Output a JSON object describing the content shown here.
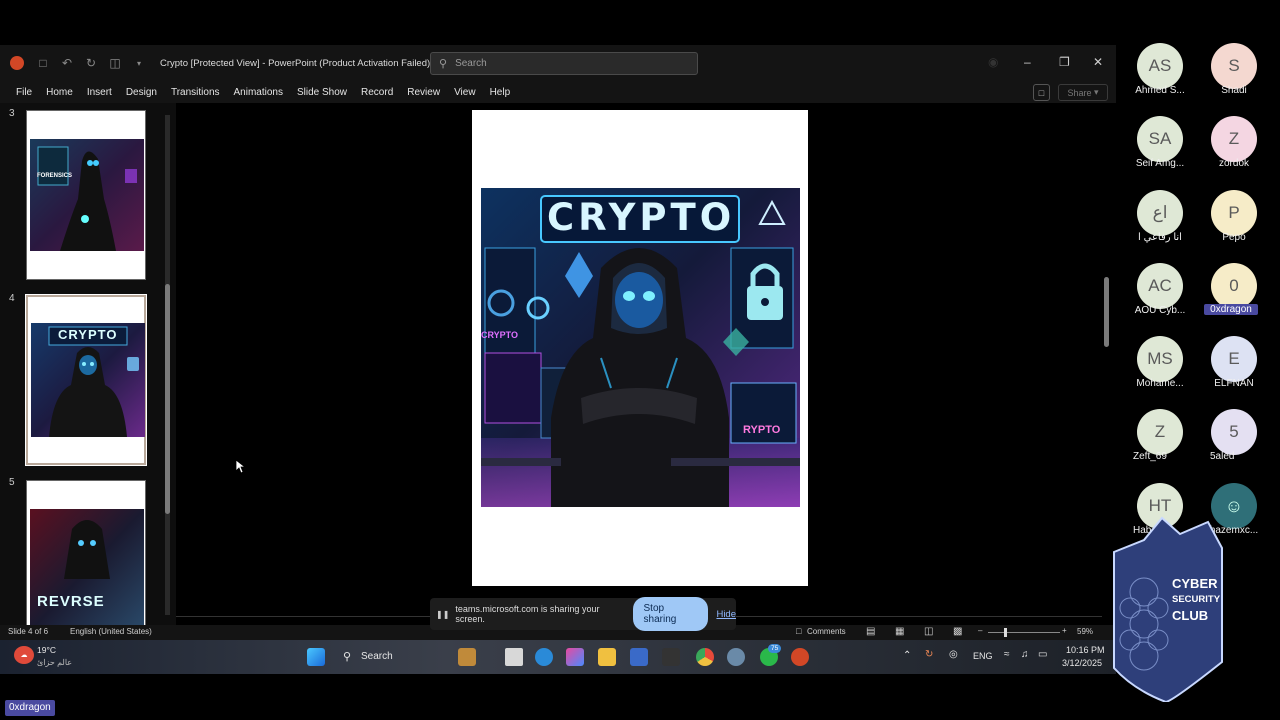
{
  "window": {
    "title": "Crypto [Protected View]  -  PowerPoint (Product Activation Failed)",
    "search_placeholder": "Search"
  },
  "menu": [
    "File",
    "Home",
    "Insert",
    "Design",
    "Transitions",
    "Animations",
    "Slide Show",
    "Record",
    "Review",
    "View",
    "Help"
  ],
  "share_label": "Share",
  "thumbnails": [
    {
      "num": "3",
      "label": "FORENSICS"
    },
    {
      "num": "4",
      "label": "CRYPTO"
    },
    {
      "num": "5",
      "label": "REVRSE"
    }
  ],
  "slide": {
    "title": "CRYPTO",
    "side_text": "CRYPTO",
    "screen_text": "RYPTO"
  },
  "status": {
    "slide_of": "Slide 4 of 6",
    "language": "English (United States)",
    "comments": "Comments",
    "zoom": "59%"
  },
  "share_banner": {
    "message": "teams.microsoft.com is sharing your screen.",
    "stop": "Stop sharing",
    "hide": "Hide"
  },
  "taskbar": {
    "weather_temp": "19°C",
    "weather_desc": "عالم حزائ",
    "search": "Search",
    "lang": "ENG",
    "time": "10:16 PM",
    "date": "3/12/2025",
    "badge_count": "75"
  },
  "participants": [
    {
      "initials": "AS",
      "name": "Ahmed S...",
      "color": "#dfe8d6"
    },
    {
      "initials": "S",
      "name": "Shadi",
      "color": "#f4d8d0"
    },
    {
      "initials": "SA",
      "name": "Seif Amg...",
      "color": "#dfe8d6"
    },
    {
      "initials": "Z",
      "name": "zordok",
      "color": "#f4d6e2"
    },
    {
      "initials": "اع",
      "name": "انا رفاعي ا",
      "color": "#dfe8d6"
    },
    {
      "initials": "P",
      "name": "Pepo",
      "color": "#f6ecc8"
    },
    {
      "initials": "AC",
      "name": "AOU Cyb...",
      "color": "#dfe8d6"
    },
    {
      "initials": "0",
      "name": "0xdragon",
      "color": "#f6ecc8"
    },
    {
      "initials": "MS",
      "name": "Mohame...",
      "color": "#dfe8d6"
    },
    {
      "initials": "E",
      "name": "ELFNAN",
      "color": "#dde2f3"
    },
    {
      "initials": "Z",
      "name": "Zeft_69",
      "color": "#dfe8d6"
    },
    {
      "initials": "5",
      "name": "5aled",
      "color": "#e4e0f2"
    },
    {
      "initials": "HT",
      "name": "Hab...",
      "color": "#dfe8d6"
    },
    {
      "initials": "",
      "name": "hazemxc...",
      "color": "#2f6f78"
    }
  ],
  "club_logo": [
    "CYBER",
    "SECURITY",
    "CLUB"
  ],
  "bottom_badge": "0xdragon"
}
